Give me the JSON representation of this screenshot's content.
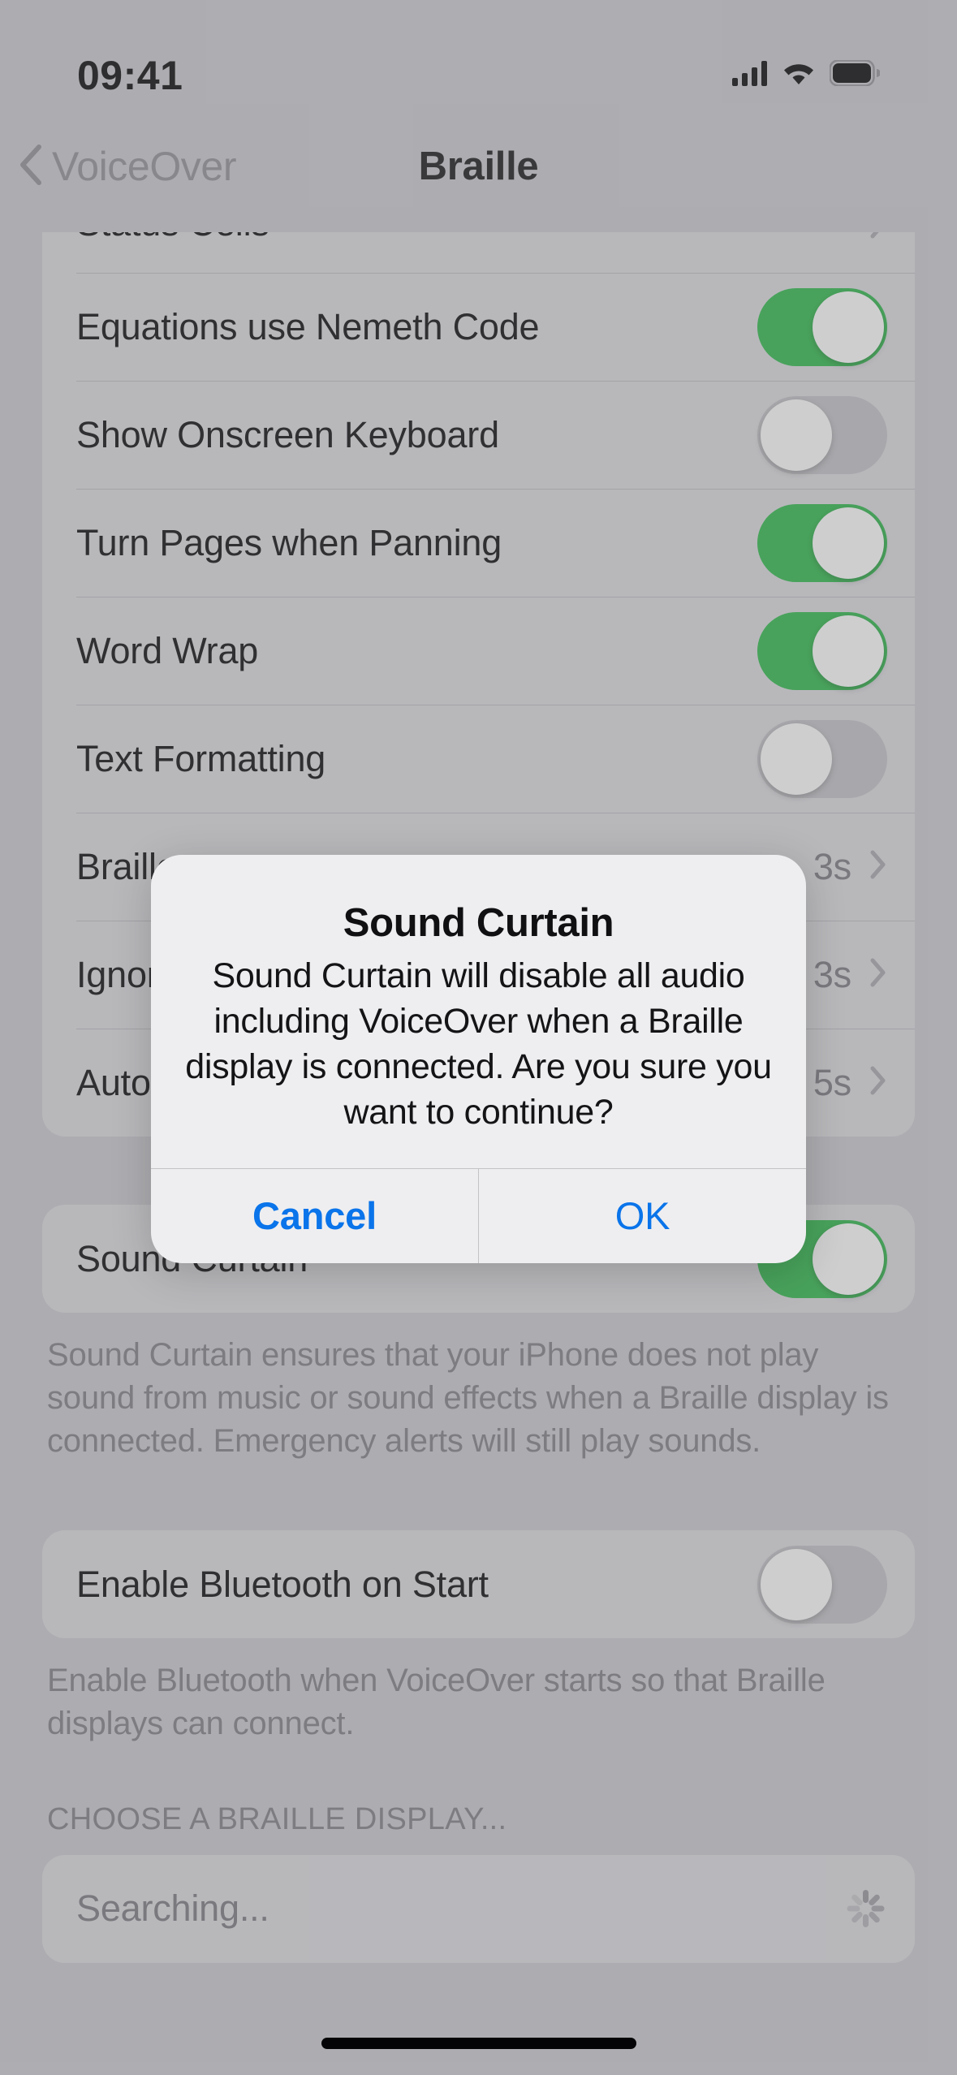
{
  "status_bar": {
    "time": "09:41",
    "icons": [
      "cellular-signal-icon",
      "wifi-icon",
      "battery-icon"
    ]
  },
  "nav_bar": {
    "back_label": "VoiceOver",
    "back_icon": "chevron-left-icon",
    "title": "Braille"
  },
  "settings": {
    "group_one": [
      {
        "label": "Status Cells",
        "type": "disclosure",
        "value": "",
        "clipped": true
      },
      {
        "label": "Equations use Nemeth Code",
        "type": "toggle",
        "state": "on"
      },
      {
        "label": "Show Onscreen Keyboard",
        "type": "toggle",
        "state": "off"
      },
      {
        "label": "Turn Pages when Panning",
        "type": "toggle",
        "state": "on"
      },
      {
        "label": "Word Wrap",
        "type": "toggle",
        "state": "on"
      },
      {
        "label": "Text Formatting",
        "type": "toggle",
        "state": "off"
      },
      {
        "label": "Braille",
        "type": "disclosure",
        "value": "3s"
      },
      {
        "label": "Ignore",
        "type": "disclosure",
        "value": "3s"
      },
      {
        "label": "Auto",
        "type": "disclosure",
        "value": "5s"
      }
    ],
    "sound_curtain_row": {
      "label": "Sound Curtain",
      "type": "toggle",
      "state": "on"
    },
    "sound_curtain_footer": "Sound Curtain ensures that your iPhone does not play sound from music or sound effects when a Braille display is connected. Emergency alerts will still play sounds.",
    "bluetooth_row": {
      "label": "Enable Bluetooth on Start",
      "type": "toggle",
      "state": "off"
    },
    "bluetooth_footer": "Enable Bluetooth when VoiceOver starts so that Braille displays can connect.",
    "choose_display_header": "CHOOSE A BRAILLE DISPLAY...",
    "searching_row": {
      "label": "Searching...",
      "accessory": "activity-spinner"
    }
  },
  "alert": {
    "title": "Sound Curtain",
    "message": "Sound Curtain will disable all audio including VoiceOver when a Braille display is connected. Are you sure you want to continue?",
    "cancel_label": "Cancel",
    "ok_label": "OK"
  },
  "colors": {
    "toggle_on": "#30b14a",
    "toggle_off": "#b9b9bd",
    "tint_blue": "#0a74ea",
    "page_background": "#c0c0c5",
    "group_background": "#d0d0d3"
  }
}
